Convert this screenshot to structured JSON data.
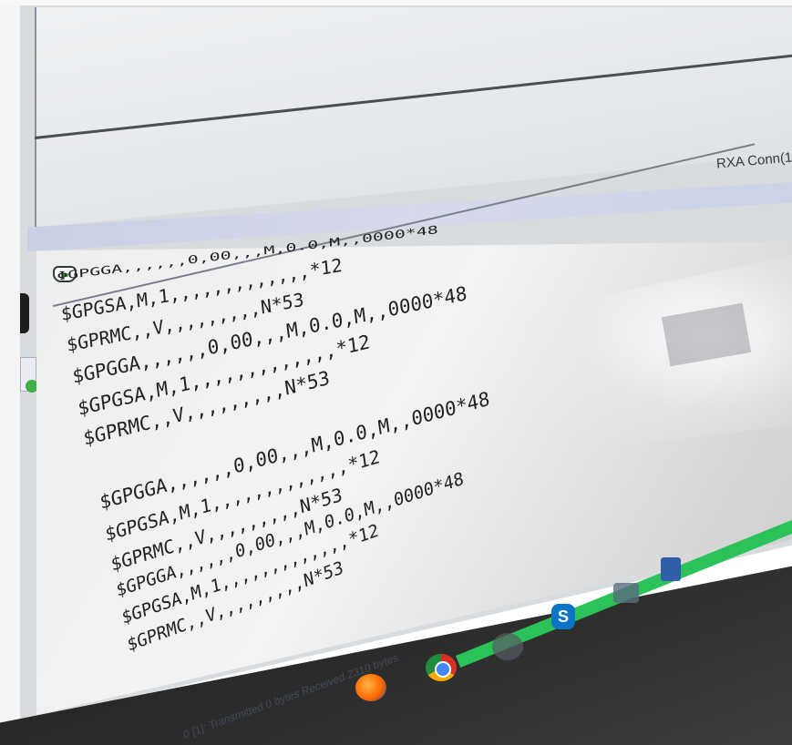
{
  "window": {
    "upper_title": "RXA Conn(1"
  },
  "terminal": {
    "icon": "terminal-connect-icon",
    "lines": [
      "ΦGPGGA,,,,,,0,00,,,M,0.0,M,,0000*48",
      "$GPGSA,M,1,,,,,,,,,,,,,*12",
      "$GPRMC,,V,,,,,,,,,N*53",
      "$GPGGA,,,,,,0,00,,,M,0.0,M,,0000*48",
      "$GPGSA,M,1,,,,,,,,,,,,,*12",
      "$GPRMC,,V,,,,,,,,,N*53",
      "$GPGGA,,,,,,0,00,,,M,0.0,M,,0000*48",
      "$GPGSA,M,1,,,,,,,,,,,,,*12",
      "$GPRMC,,V,,,,,,,,,N*53",
      "$GPGGA,,,,,,0,00,,,M,0.0,M,,0000*48",
      "$GPGSA,M,1,,,,,,,,,,,,,*12",
      "$GPRMC,,V,,,,,,,,,N*53"
    ]
  },
  "status_bar": {
    "text": "0 [1]: Transmitted 0 bytes  Received 2310 bytes"
  },
  "taskbar": {
    "icons": [
      "firefox-icon",
      "chrome-icon",
      "pinned-app-icon",
      "skype-icon",
      "tool-icon",
      "word-icon"
    ],
    "skype_glyph": "S"
  },
  "colors": {
    "taskbar_accent": "#2cc25a",
    "terminal_text": "#222222"
  }
}
